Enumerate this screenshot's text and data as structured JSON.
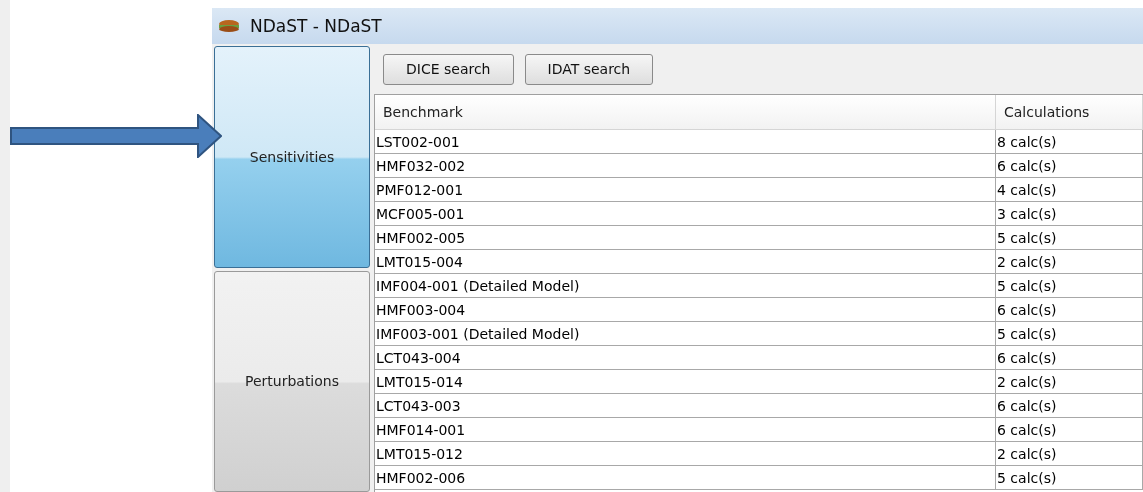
{
  "window": {
    "title": "NDaST - NDaST"
  },
  "side_tabs": [
    {
      "label": "Sensitivities",
      "selected": true
    },
    {
      "label": "Perturbations",
      "selected": false
    }
  ],
  "toolbar": {
    "buttons": [
      "DICE search",
      "IDAT search"
    ]
  },
  "table": {
    "columns": [
      "Benchmark",
      "Calculations"
    ],
    "rows": [
      [
        "LST002-001",
        "8 calc(s)"
      ],
      [
        "HMF032-002",
        "6 calc(s)"
      ],
      [
        "PMF012-001",
        "4 calc(s)"
      ],
      [
        "MCF005-001",
        "3 calc(s)"
      ],
      [
        "HMF002-005",
        "5 calc(s)"
      ],
      [
        "LMT015-004",
        "2 calc(s)"
      ],
      [
        "IMF004-001 (Detailed Model)",
        "5 calc(s)"
      ],
      [
        "HMF003-004",
        "6 calc(s)"
      ],
      [
        "IMF003-001 (Detailed Model)",
        "5 calc(s)"
      ],
      [
        "LCT043-004",
        "6 calc(s)"
      ],
      [
        "LMT015-014",
        "2 calc(s)"
      ],
      [
        "LCT043-003",
        "6 calc(s)"
      ],
      [
        "HMF014-001",
        "6 calc(s)"
      ],
      [
        "LMT015-012",
        "2 calc(s)"
      ],
      [
        "HMF002-006",
        "5 calc(s)"
      ]
    ]
  }
}
